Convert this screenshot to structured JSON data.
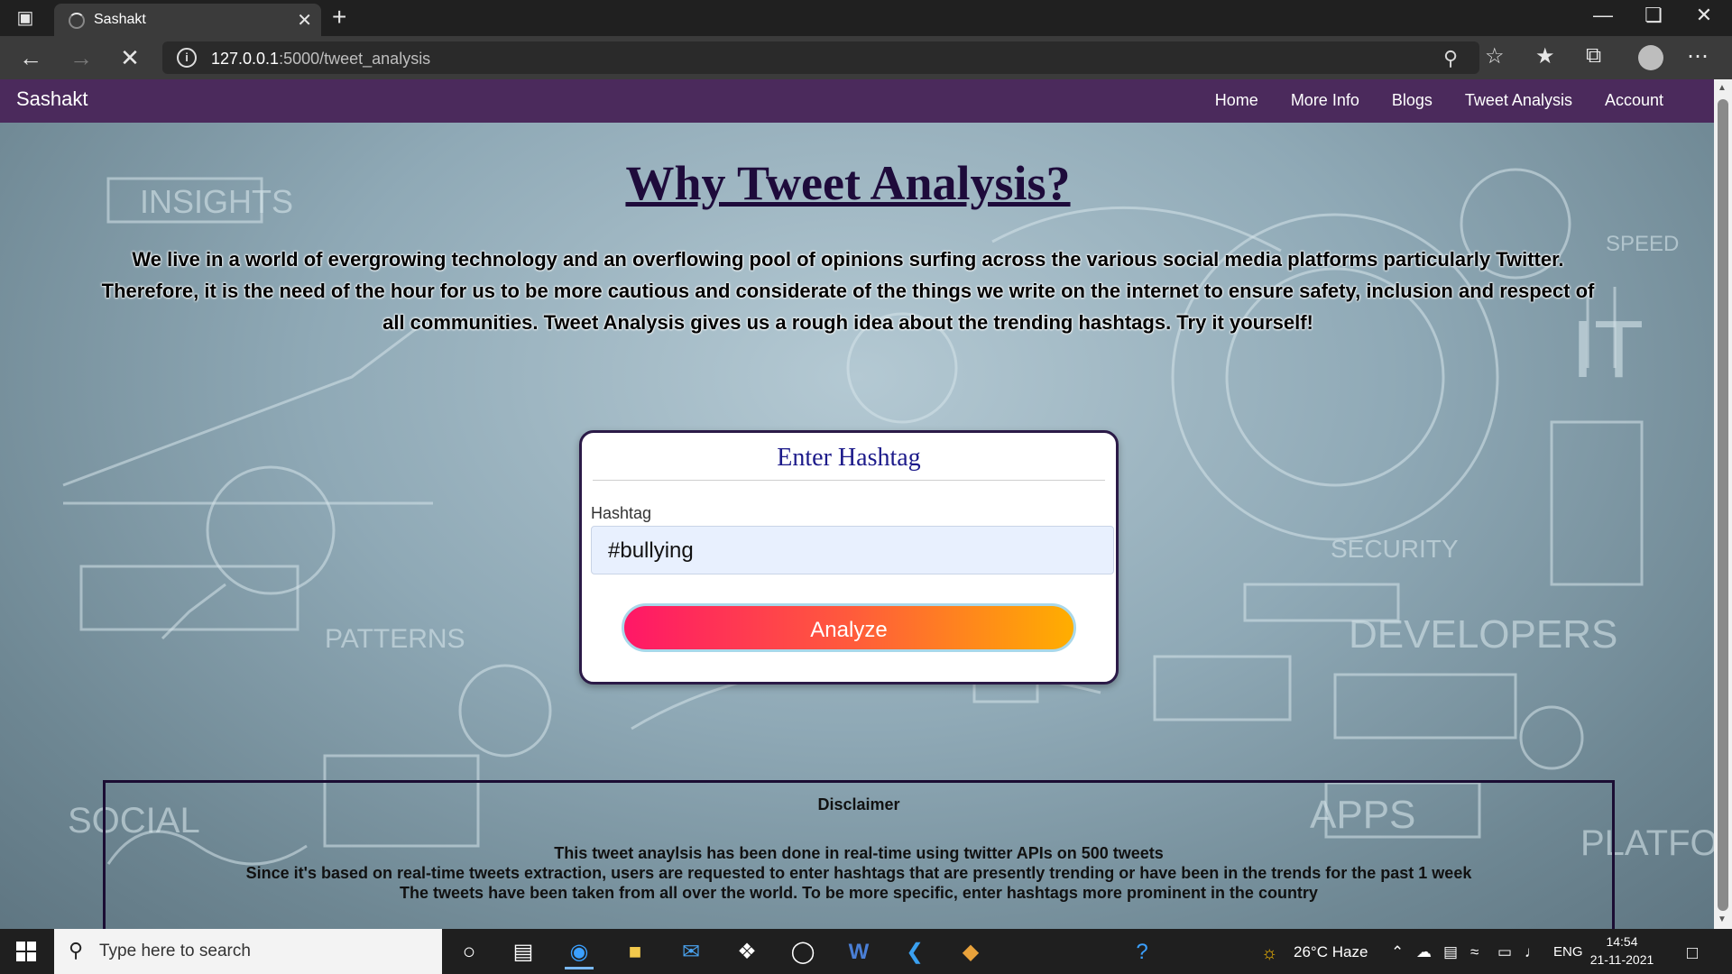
{
  "browser": {
    "tab_title": "Sashakt",
    "url_host": "127.0.0.1",
    "url_rest": ":5000/tweet_analysis"
  },
  "site": {
    "brand": "Sashakt",
    "nav": [
      "Home",
      "More Info",
      "Blogs",
      "Tweet Analysis",
      "Account"
    ]
  },
  "main": {
    "title": "Why Tweet Analysis?",
    "intro": "We live in a world of evergrowing technology and an overflowing pool of opinions surfing across the various social media platforms particularly Twitter. Therefore, it is the need of the hour for us to be more cautious and considerate of the things we write on the internet to ensure safety, inclusion and respect of all communities. Tweet Analysis gives us a rough idea about the trending hashtags. Try it yourself!"
  },
  "form": {
    "heading": "Enter Hashtag",
    "label": "Hashtag",
    "value": "#bullying",
    "button": "Analyze"
  },
  "disclaimer": {
    "title": "Disclaimer",
    "lines": [
      "This tweet anaylsis has been done in real-time using twitter APIs on 500 tweets",
      "Since it's based on real-time tweets extraction, users are requested to enter hashtags that are presently trending or have been in the trends for the past 1 week",
      "The tweets have been taken from all over the world. To be more specific, enter hashtags more prominent in the country"
    ]
  },
  "background_words": [
    "INSIGHTS",
    "PATTERNS",
    "SOCIAL",
    "SECURITY",
    "DEVELOPERS",
    "APPS",
    "PLATFORM",
    "IT",
    "SPEED"
  ],
  "taskbar": {
    "search_placeholder": "Type here to search",
    "weather": "26°C  Haze",
    "language": "ENG",
    "time": "14:54",
    "date": "21-11-2021"
  },
  "colors": {
    "site_nav": "#4b2a5c",
    "title": "#1e0b3b",
    "button_gradient_start": "#ff1767",
    "button_gradient_end": "#ffae00"
  }
}
